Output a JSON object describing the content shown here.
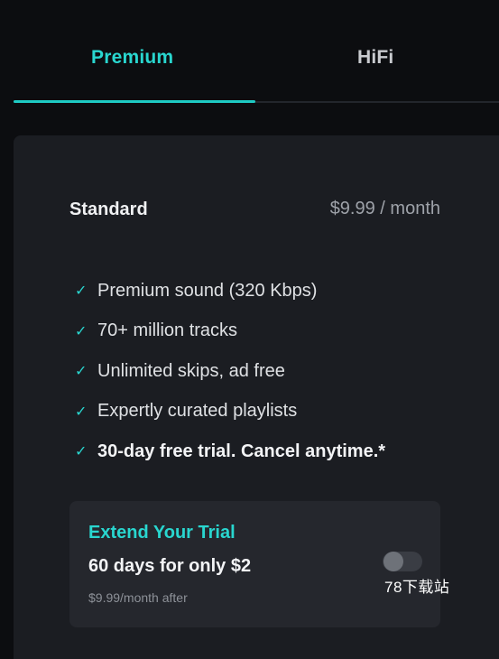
{
  "tabs": {
    "premium_label": "Premium",
    "hifi_label": "HiFi",
    "active": "Premium"
  },
  "plan": {
    "name": "Standard",
    "price": "$9.99 / month"
  },
  "features": [
    {
      "text": "Premium sound (320 Kbps)",
      "bold": false
    },
    {
      "text": "70+ million tracks",
      "bold": false
    },
    {
      "text": "Unlimited skips, ad free",
      "bold": false
    },
    {
      "text": "Expertly curated playlists",
      "bold": false
    },
    {
      "text": "30-day free trial. Cancel anytime.*",
      "bold": true
    }
  ],
  "check_glyph": "✓",
  "trial": {
    "title": "Extend Your Trial",
    "offer": "60 days for only $2",
    "note": "$9.99/month after",
    "toggle_on": false
  },
  "watermark": "78下载站",
  "colors": {
    "accent": "#29d6cf",
    "background": "#0c0d10",
    "card": "#1b1d22",
    "trial_box": "#25272d"
  }
}
